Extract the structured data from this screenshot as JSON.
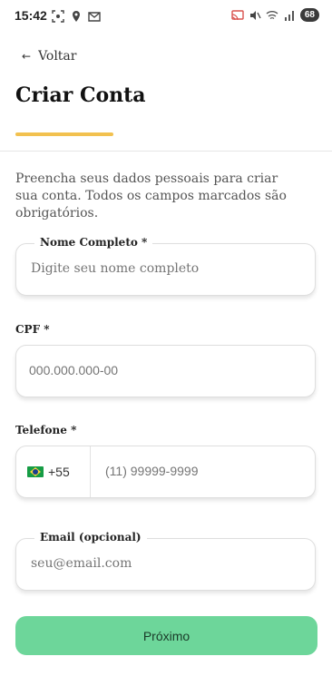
{
  "status_bar": {
    "time": "15:42",
    "battery": "68"
  },
  "nav": {
    "back_label": "Voltar"
  },
  "page": {
    "title": "Criar Conta",
    "intro": "Preencha seus dados pessoais para criar sua conta. Todos os campos marcados são obrigatórios."
  },
  "form": {
    "name": {
      "label": "Nome Completo *",
      "placeholder": "Digite seu nome completo"
    },
    "cpf": {
      "label": "CPF *",
      "placeholder": "000.000.000-00"
    },
    "phone": {
      "label": "Telefone *",
      "country_code": "+55",
      "placeholder": "(11) 99999-9999"
    },
    "email": {
      "label": "Email (opcional)",
      "placeholder": "seu@email.com"
    }
  },
  "actions": {
    "next_label": "Próximo"
  },
  "colors": {
    "accent": "#f2c14f",
    "primary_button": "#6dd69a"
  }
}
